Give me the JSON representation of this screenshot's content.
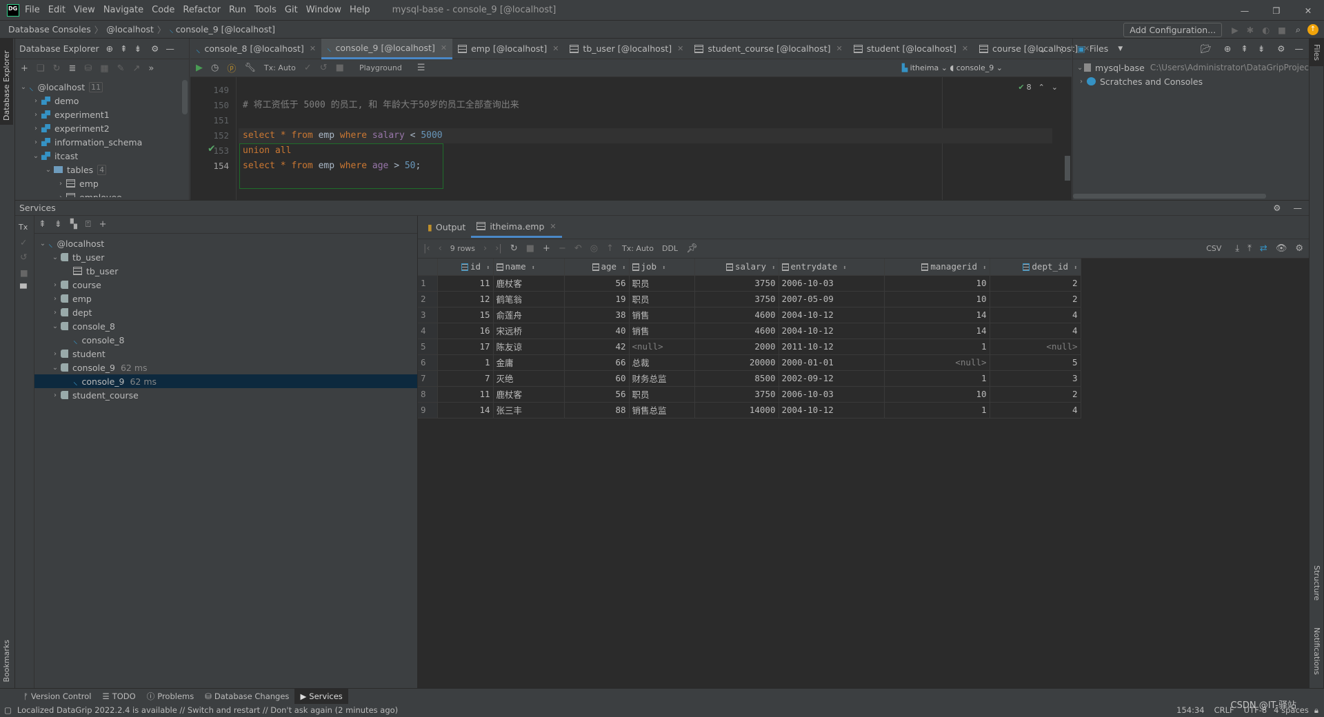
{
  "app": {
    "logo": "DG",
    "menu": [
      "File",
      "Edit",
      "View",
      "Navigate",
      "Code",
      "Refactor",
      "Run",
      "Tools",
      "Git",
      "Window",
      "Help"
    ],
    "title": "mysql-base - console_9 [@localhost]"
  },
  "breadcrumb": [
    "Database Consoles",
    "@localhost",
    "console_9 [@localhost]"
  ],
  "nav": {
    "add_configuration": "Add Configuration..."
  },
  "db_explorer": {
    "title": "Database Explorer",
    "stripe_label": "Database Explorer",
    "tree": [
      {
        "label": "@localhost",
        "badge": "11",
        "level": 0,
        "expanded": true,
        "icon": "mysql-icon"
      },
      {
        "label": "demo",
        "level": 1,
        "expanded": false,
        "icon": "schema-icon"
      },
      {
        "label": "experiment1",
        "level": 1,
        "expanded": false,
        "icon": "schema-icon"
      },
      {
        "label": "experiment2",
        "level": 1,
        "expanded": false,
        "icon": "schema-icon"
      },
      {
        "label": "information_schema",
        "level": 1,
        "expanded": false,
        "icon": "schema-icon"
      },
      {
        "label": "itcast",
        "level": 1,
        "expanded": true,
        "icon": "schema-icon"
      },
      {
        "label": "tables",
        "badge": "4",
        "level": 2,
        "expanded": true,
        "icon": "folder-icon"
      },
      {
        "label": "emp",
        "level": 3,
        "expanded": false,
        "icon": "table-icon"
      },
      {
        "label": "employee",
        "level": 3,
        "expanded": false,
        "icon": "table-icon"
      }
    ]
  },
  "editor": {
    "tabs": [
      {
        "label": "console_8 [@localhost]",
        "icon": "console-icon",
        "active": false
      },
      {
        "label": "console_9 [@localhost]",
        "icon": "console-icon",
        "active": true
      },
      {
        "label": "emp [@localhost]",
        "icon": "table-icon",
        "active": false
      },
      {
        "label": "tb_user [@localhost]",
        "icon": "table-icon",
        "active": false
      },
      {
        "label": "student_course [@localhost]",
        "icon": "table-icon",
        "active": false
      },
      {
        "label": "student [@localhost]",
        "icon": "table-icon",
        "active": false
      },
      {
        "label": "course [@localhost]",
        "icon": "table-icon",
        "active": false
      }
    ],
    "toolbar": {
      "tx": "Tx: Auto",
      "playground": "Playground",
      "schema": "itheima",
      "session": "console_9"
    },
    "inspection_count": "8",
    "lines": [
      {
        "n": "149",
        "code": ""
      },
      {
        "n": "150",
        "code": "# 将工资低于 5000 的员工, 和 年龄大于50岁的员工全部查询出来"
      },
      {
        "n": "151",
        "code": ""
      },
      {
        "n": "152",
        "code": "select * from emp where salary < 5000"
      },
      {
        "n": "153",
        "code": "union all"
      },
      {
        "n": "154",
        "code": "select * from emp where age > 50;"
      }
    ]
  },
  "files": {
    "title": "Files",
    "stripe_label": "Files",
    "tree": [
      {
        "label": "mysql-base",
        "path": "C:\\Users\\Administrator\\DataGripProjec"
      },
      {
        "label": "Scratches and Consoles"
      }
    ]
  },
  "services": {
    "title": "Services",
    "tx": "Tx",
    "tree": [
      {
        "label": "@localhost",
        "level": 0,
        "expanded": true,
        "icon": "mysql-icon"
      },
      {
        "label": "tb_user",
        "level": 1,
        "expanded": true,
        "icon": "service-icon"
      },
      {
        "label": "tb_user",
        "level": 2,
        "icon": "table-icon"
      },
      {
        "label": "course",
        "level": 1,
        "expanded": false,
        "icon": "service-icon"
      },
      {
        "label": "emp",
        "level": 1,
        "expanded": false,
        "icon": "service-icon"
      },
      {
        "label": "dept",
        "level": 1,
        "expanded": false,
        "icon": "service-icon"
      },
      {
        "label": "console_8",
        "level": 1,
        "expanded": true,
        "icon": "service-icon"
      },
      {
        "label": "console_8",
        "level": 2,
        "icon": "console-icon"
      },
      {
        "label": "student",
        "level": 1,
        "expanded": false,
        "icon": "service-icon"
      },
      {
        "label": "console_9",
        "time": "62 ms",
        "level": 1,
        "expanded": true,
        "icon": "service-icon"
      },
      {
        "label": "console_9",
        "time": "62 ms",
        "level": 2,
        "icon": "console-icon",
        "selected": true
      },
      {
        "label": "student_course",
        "level": 1,
        "expanded": false,
        "icon": "service-icon"
      }
    ]
  },
  "results": {
    "tabs": [
      "Output",
      "itheima.emp"
    ],
    "rows_label": "9 rows",
    "tx": "Tx: Auto",
    "ddl": "DDL",
    "export": "CSV",
    "columns": [
      "id",
      "name",
      "age",
      "job",
      "salary",
      "entrydate",
      "managerid",
      "dept_id"
    ],
    "rows": [
      [
        "1",
        "11",
        "鹿杖客",
        "56",
        "职员",
        "3750",
        "2006-10-03",
        "10",
        "2"
      ],
      [
        "2",
        "12",
        "鹤笔翁",
        "19",
        "职员",
        "3750",
        "2007-05-09",
        "10",
        "2"
      ],
      [
        "3",
        "15",
        "俞莲舟",
        "38",
        "销售",
        "4600",
        "2004-10-12",
        "14",
        "4"
      ],
      [
        "4",
        "16",
        "宋远桥",
        "40",
        "销售",
        "4600",
        "2004-10-12",
        "14",
        "4"
      ],
      [
        "5",
        "17",
        "陈友谅",
        "42",
        "<null>",
        "2000",
        "2011-10-12",
        "1",
        "<null>"
      ],
      [
        "6",
        "1",
        "金庸",
        "66",
        "总裁",
        "20000",
        "2000-01-01",
        "<null>",
        "5"
      ],
      [
        "7",
        "7",
        "灭绝",
        "60",
        "财务总监",
        "8500",
        "2002-09-12",
        "1",
        "3"
      ],
      [
        "8",
        "11",
        "鹿杖客",
        "56",
        "职员",
        "3750",
        "2006-10-03",
        "10",
        "2"
      ],
      [
        "9",
        "14",
        "张三丰",
        "88",
        "销售总监",
        "14000",
        "2004-10-12",
        "1",
        "4"
      ]
    ]
  },
  "bottom_tabs": [
    "Version Control",
    "TODO",
    "Problems",
    "Database Changes",
    "Services"
  ],
  "left_stripe_bottom": "Bookmarks",
  "right_stripe": [
    "Structure",
    "Notifications"
  ],
  "status": {
    "message": "Localized DataGrip 2022.2.4 is available // Switch and restart // Don't ask again (2 minutes ago)",
    "position": "154:34",
    "line_sep": "CRLF",
    "encoding": "UTF-8",
    "indent": "4 spaces",
    "watermark": "CSDN @IT-驿站"
  }
}
